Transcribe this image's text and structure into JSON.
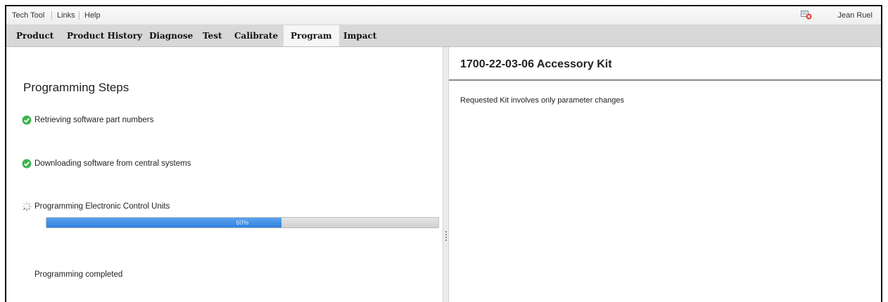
{
  "menu": {
    "items": [
      "Tech Tool",
      "Links",
      "Help"
    ],
    "user_name": "Jean Ruel",
    "user_icon": "user-logout-icon"
  },
  "tabs": [
    {
      "label": "Product",
      "active": false
    },
    {
      "label": "Product History",
      "active": false
    },
    {
      "label": "Diagnose",
      "active": false
    },
    {
      "label": "Test",
      "active": false
    },
    {
      "label": "Calibrate",
      "active": false
    },
    {
      "label": "Program",
      "active": true
    },
    {
      "label": "Impact",
      "active": false
    }
  ],
  "steps": {
    "title": "Programming Steps",
    "items": [
      {
        "label": "Retrieving software part numbers",
        "status": "done",
        "icon": "check-circle-icon"
      },
      {
        "label": "Downloading software from central systems",
        "status": "done",
        "icon": "check-circle-icon"
      },
      {
        "label": "Programming Electronic Control Units",
        "status": "in-progress",
        "icon": "spinner-icon"
      }
    ],
    "progress": {
      "value": 0.6,
      "label": "60%"
    },
    "completed_label": "Programming completed"
  },
  "kit": {
    "title": "1700-22-03-06 Accessory Kit",
    "message": "Requested Kit involves only parameter changes"
  },
  "colors": {
    "progress_fill": "#2f80df",
    "check_green": "#3fb34f",
    "tab_bar": "#d8d8d8"
  }
}
